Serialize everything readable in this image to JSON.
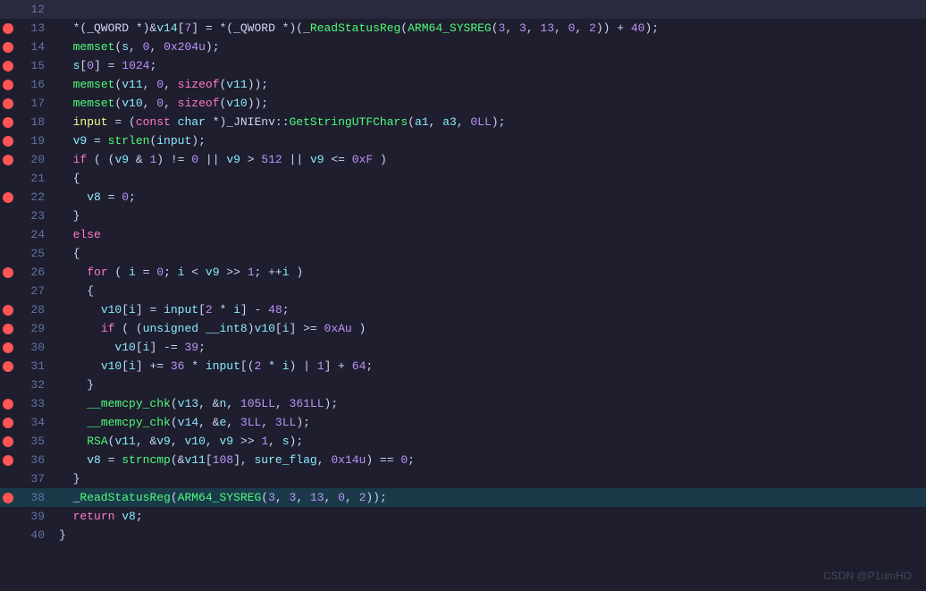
{
  "watermark": "CSDN @P1umHO",
  "lines": [
    {
      "num": 12,
      "hasBreakpoint": false,
      "highlight": false,
      "content": "empty_12"
    },
    {
      "num": 13,
      "hasBreakpoint": true,
      "highlight": false,
      "content": "line_13"
    },
    {
      "num": 14,
      "hasBreakpoint": true,
      "highlight": false,
      "content": "line_14"
    },
    {
      "num": 15,
      "hasBreakpoint": true,
      "highlight": false,
      "content": "line_15"
    },
    {
      "num": 16,
      "hasBreakpoint": true,
      "highlight": false,
      "content": "line_16"
    },
    {
      "num": 17,
      "hasBreakpoint": true,
      "highlight": false,
      "content": "line_17"
    },
    {
      "num": 18,
      "hasBreakpoint": true,
      "highlight": false,
      "content": "line_18"
    },
    {
      "num": 19,
      "hasBreakpoint": true,
      "highlight": false,
      "content": "line_19"
    },
    {
      "num": 20,
      "hasBreakpoint": true,
      "highlight": false,
      "content": "line_20"
    },
    {
      "num": 21,
      "hasBreakpoint": false,
      "highlight": false,
      "content": "line_21"
    },
    {
      "num": 22,
      "hasBreakpoint": true,
      "highlight": false,
      "content": "line_22"
    },
    {
      "num": 23,
      "hasBreakpoint": false,
      "highlight": false,
      "content": "line_23"
    },
    {
      "num": 24,
      "hasBreakpoint": false,
      "highlight": false,
      "content": "line_24"
    },
    {
      "num": 25,
      "hasBreakpoint": false,
      "highlight": false,
      "content": "line_25"
    },
    {
      "num": 26,
      "hasBreakpoint": true,
      "highlight": false,
      "content": "line_26"
    },
    {
      "num": 27,
      "hasBreakpoint": false,
      "highlight": false,
      "content": "line_27"
    },
    {
      "num": 28,
      "hasBreakpoint": true,
      "highlight": false,
      "content": "line_28"
    },
    {
      "num": 29,
      "hasBreakpoint": true,
      "highlight": false,
      "content": "line_29"
    },
    {
      "num": 30,
      "hasBreakpoint": true,
      "highlight": false,
      "content": "line_30"
    },
    {
      "num": 31,
      "hasBreakpoint": true,
      "highlight": false,
      "content": "line_31"
    },
    {
      "num": 32,
      "hasBreakpoint": false,
      "highlight": false,
      "content": "line_32"
    },
    {
      "num": 33,
      "hasBreakpoint": true,
      "highlight": false,
      "content": "line_33"
    },
    {
      "num": 34,
      "hasBreakpoint": true,
      "highlight": false,
      "content": "line_34"
    },
    {
      "num": 35,
      "hasBreakpoint": true,
      "highlight": false,
      "content": "line_35"
    },
    {
      "num": 36,
      "hasBreakpoint": true,
      "highlight": false,
      "content": "line_36"
    },
    {
      "num": 37,
      "hasBreakpoint": false,
      "highlight": false,
      "content": "line_37"
    },
    {
      "num": 38,
      "hasBreakpoint": true,
      "highlight": true,
      "content": "line_38"
    },
    {
      "num": 39,
      "hasBreakpoint": false,
      "highlight": false,
      "content": "line_39"
    },
    {
      "num": 40,
      "hasBreakpoint": false,
      "highlight": false,
      "content": "line_40"
    }
  ]
}
